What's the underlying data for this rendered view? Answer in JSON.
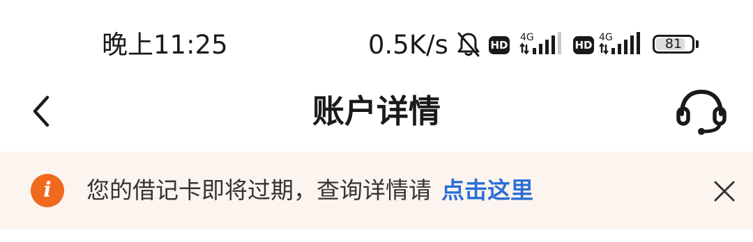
{
  "status_bar": {
    "time": "晚上11:25",
    "network_speed": "0.5K/s",
    "bell_icon": "bell-muted-icon",
    "sim1": {
      "hd": "HD",
      "network": "4G",
      "signal_bars": 4
    },
    "sim2": {
      "hd": "HD",
      "network": "4G",
      "signal_bars": 5
    },
    "battery": {
      "level": "81",
      "fraction": 0.81
    }
  },
  "nav": {
    "back_icon": "chevron-left-icon",
    "title": "账户详情",
    "support_icon": "headset-icon"
  },
  "notice": {
    "icon": "info-icon",
    "icon_glyph": "i",
    "message": "您的借记卡即将过期，查询详情请",
    "link_label": "点击这里",
    "close_icon": "close-icon",
    "background_color": "#fcf4ef",
    "icon_color": "#f06a1d",
    "link_color": "#2a6fd6"
  }
}
